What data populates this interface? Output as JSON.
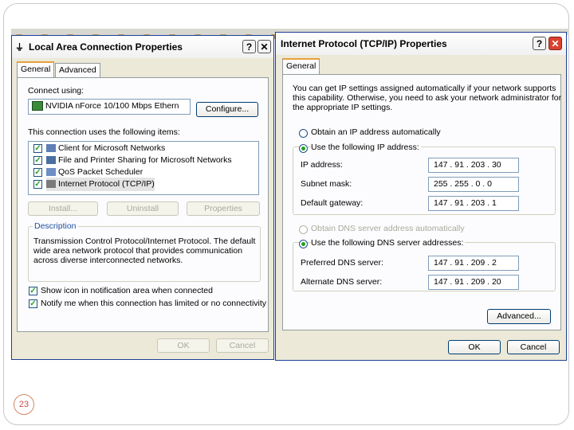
{
  "page_number": "23",
  "left_dialog": {
    "title": "Local Area Connection Properties",
    "help_btn": "?",
    "close_btn": "✕",
    "tabs": [
      "General",
      "Advanced"
    ],
    "connect_using_label": "Connect using:",
    "adapter_name": "NVIDIA nForce 10/100 Mbps Ethern",
    "configure_button": "Configure...",
    "items_label": "This connection uses the following items:",
    "items": [
      {
        "label": "Client for Microsoft Networks",
        "checked": true,
        "icon": "network-client-icon"
      },
      {
        "label": "File and Printer Sharing for Microsoft Networks",
        "checked": true,
        "icon": "printer-sharing-icon"
      },
      {
        "label": "QoS Packet Scheduler",
        "checked": true,
        "icon": "qos-icon"
      },
      {
        "label": "Internet Protocol (TCP/IP)",
        "checked": true,
        "icon": "protocol-icon",
        "selected": true
      }
    ],
    "install_button": "Install...",
    "uninstall_button": "Uninstall",
    "properties_button": "Properties",
    "description_label": "Description",
    "description_lines": [
      "Transmission Control Protocol/Internet Protocol. The default",
      "wide area network protocol that provides communication",
      "across diverse interconnected networks."
    ],
    "show_icon_label": "Show icon in notification area when connected",
    "notify_label": "Notify me when this connection has limited or no connectivity",
    "ok_button": "OK",
    "cancel_button": "Cancel"
  },
  "right_dialog": {
    "title": "Internet Protocol (TCP/IP) Properties",
    "help_btn": "?",
    "close_btn": "✕",
    "tabs": [
      "General"
    ],
    "intro_lines": [
      "You can get IP settings assigned automatically if your network supports",
      "this capability. Otherwise, you need to ask your network administrator for",
      "the appropriate IP settings."
    ],
    "obtain_ip_auto": "Obtain an IP address automatically",
    "use_following_ip": "Use the following IP address:",
    "ip_address_label": "IP address:",
    "ip_address": "147 . 91 . 203 . 30",
    "subnet_label": "Subnet mask:",
    "subnet": "255 . 255 . 0 . 0",
    "gateway_label": "Default gateway:",
    "gateway": "147 . 91 . 203 . 1",
    "obtain_dns_auto": "Obtain DNS server address automatically",
    "use_following_dns": "Use the following DNS server addresses:",
    "preferred_dns_label": "Preferred DNS server:",
    "preferred_dns": "147 . 91 . 209 . 2",
    "alternate_dns_label": "Alternate DNS server:",
    "alternate_dns": "147 . 91 . 209 . 20",
    "advanced_button": "Advanced...",
    "ok_button": "OK",
    "cancel_button": "Cancel"
  }
}
